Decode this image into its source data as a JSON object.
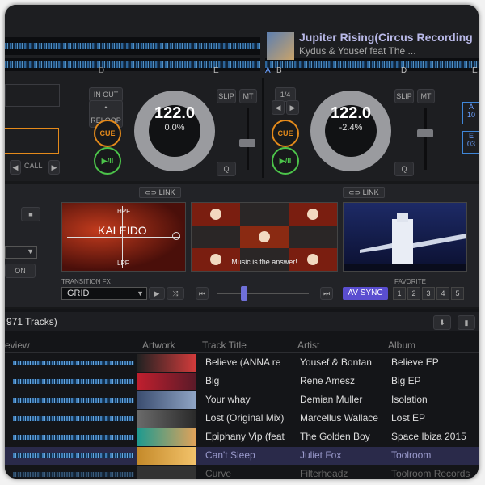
{
  "colors": {
    "accent_blue": "#3f86d8",
    "cue_orange": "#e48a1b",
    "play_green": "#4cc44a",
    "av_sync": "#5a4ed0",
    "selected_row": "#2a2a4a"
  },
  "deck_right": {
    "title": "Jupiter Rising(Circus Recording",
    "artist": "Kydus & Yousef feat The ..."
  },
  "deck_left": {
    "in_out_label": "IN  OUT",
    "reloop_label": "• RELOOP",
    "call_label": "CALL",
    "cue_label": "CUE",
    "play_label": "▶/II",
    "slip_label": "SLIP",
    "mt_label": "MT",
    "q_label": "Q",
    "bpm": "122.0",
    "pitch": "0.0%"
  },
  "deck_right_ctrl": {
    "loop_size": "1/4",
    "cue_label": "CUE",
    "play_label": "▶/II",
    "slip_label": "SLIP",
    "mt_label": "MT",
    "q_label": "Q",
    "bpm": "122.0",
    "pitch": "-2.4%",
    "side_a": "A",
    "side_a_num": "10",
    "side_e": "E",
    "side_e_num": "03"
  },
  "markers_left": [
    "D",
    "E"
  ],
  "markers_right": [
    "A",
    "B",
    "D",
    "E"
  ],
  "fx": {
    "link_left": "LINK",
    "link_right": "LINK",
    "kaleido_title": "KALEIDO",
    "hpf": "HPF",
    "lpf": "LPF",
    "center_caption": "Music is the answer!",
    "on_label": "ON",
    "transition_label": "TRANSITION FX",
    "transition_value": "GRID",
    "av_sync": "AV SYNC",
    "favorite_label": "FAVORITE",
    "favorites": [
      "1",
      "2",
      "3",
      "4",
      "5"
    ]
  },
  "library": {
    "count_label": "971 Tracks)",
    "headers": {
      "preview": "eview",
      "artwork": "Artwork",
      "title": "Track Title",
      "artist": "Artist",
      "album": "Album"
    },
    "rows": [
      {
        "title": "Believe (ANNA re",
        "artist": "Yousef & Bontan",
        "album": "Believe EP"
      },
      {
        "title": "Big",
        "artist": "Rene Amesz",
        "album": "Big EP"
      },
      {
        "title": "Your whay",
        "artist": "Demian Muller",
        "album": "Isolation"
      },
      {
        "title": "Lost (Original Mix)",
        "artist": "Marcellus Wallace",
        "album": "Lost EP"
      },
      {
        "title": "Epiphany Vip (feat",
        "artist": "The Golden Boy",
        "album": "Space Ibiza 2015"
      },
      {
        "title": "Can't Sleep",
        "artist": "Juliet Fox",
        "album": "Toolroom"
      },
      {
        "title": "Curve",
        "artist": "Filterheadz",
        "album": "Toolroom Records"
      }
    ]
  }
}
